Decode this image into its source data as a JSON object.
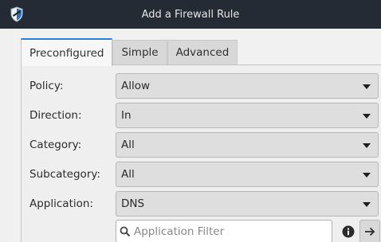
{
  "window": {
    "title": "Add a Firewall Rule"
  },
  "tabs": [
    {
      "label": "Preconfigured",
      "active": true
    },
    {
      "label": "Simple",
      "active": false
    },
    {
      "label": "Advanced",
      "active": false
    }
  ],
  "form": {
    "policy": {
      "label": "Policy:",
      "value": "Allow"
    },
    "direction": {
      "label": "Direction:",
      "value": "In"
    },
    "category": {
      "label": "Category:",
      "value": "All"
    },
    "subcategory": {
      "label": "Subcategory:",
      "value": "All"
    },
    "application": {
      "label": "Application:",
      "value": "DNS"
    },
    "filter": {
      "placeholder": "Application Filter",
      "value": ""
    }
  },
  "icons": {
    "app": "shield-icon",
    "search": "search-icon",
    "info": "info-icon",
    "go": "arrow-right-icon",
    "dropdown": "triangle-down-icon"
  },
  "colors": {
    "titlebar": "#252b34",
    "accent": "#2a7fd4",
    "combo_bg": "#dedede"
  }
}
